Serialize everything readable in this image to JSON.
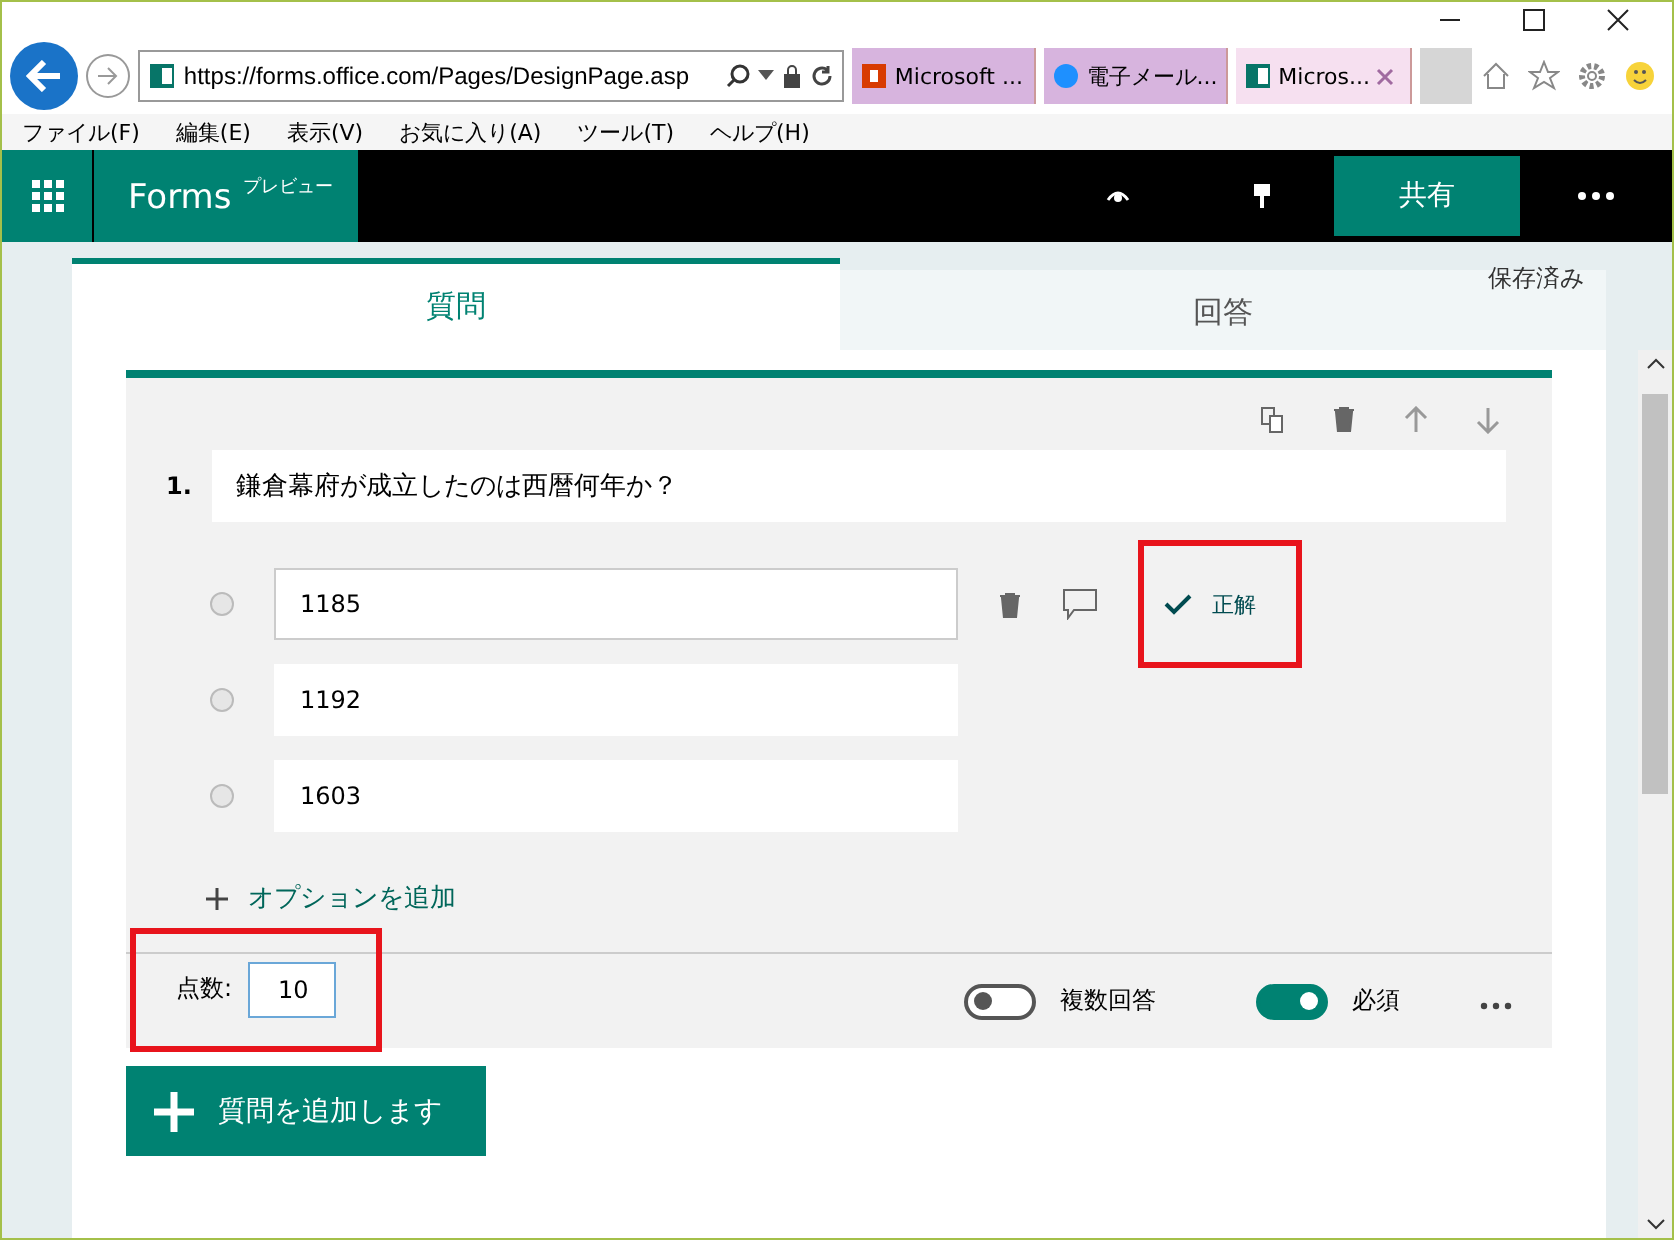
{
  "browser": {
    "url": "https://forms.office.com/Pages/DesignPage.asp",
    "tabs": [
      {
        "title": "Microsoft ...",
        "kind": "office",
        "selected": false
      },
      {
        "title": "電子メール...",
        "kind": "ie",
        "selected": false
      },
      {
        "title": "Micros...",
        "kind": "forms",
        "selected": true
      }
    ],
    "menu": [
      "ファイル(F)",
      "編集(E)",
      "表示(V)",
      "お気に入り(A)",
      "ツール(T)",
      "ヘルプ(H)"
    ]
  },
  "app": {
    "title": "Forms",
    "badge": "プレビュー",
    "share": "共有"
  },
  "tabs": [
    {
      "label": "質問",
      "selected": true
    },
    {
      "label": "回答",
      "selected": false
    }
  ],
  "save_status": "保存済み",
  "question": {
    "number": "1.",
    "text": "鎌倉幕府が成立したのは西暦何年か？",
    "options": [
      {
        "text": "1185",
        "selected": false,
        "show_tools": true
      },
      {
        "text": "1192",
        "selected": false,
        "show_tools": false
      },
      {
        "text": "1603",
        "selected": false,
        "show_tools": false
      }
    ],
    "correct_label": "正解",
    "add_option": "オプションを追加",
    "points_label": "点数:",
    "points": "10",
    "toggles": [
      {
        "label": "複数回答",
        "on": false
      },
      {
        "label": "必須",
        "on": true
      }
    ]
  },
  "add_question": "質問を追加します"
}
